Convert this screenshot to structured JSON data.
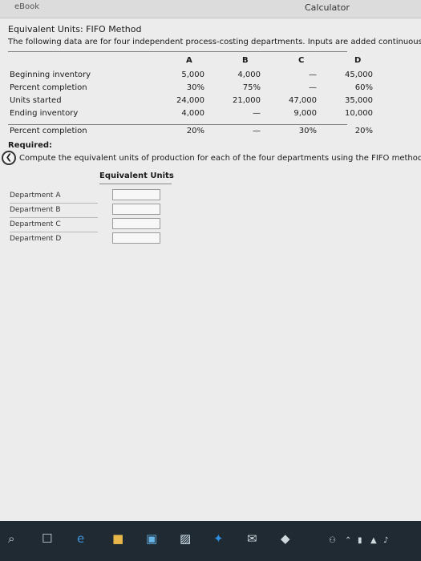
{
  "topbar": {
    "ebook": "eBook",
    "calculator": "Calculator"
  },
  "title": "Equivalent Units: FIFO Method",
  "intro": "The following data are for four independent process-costing departments. Inputs are added continuously.",
  "columns": [
    "A",
    "B",
    "C",
    "D"
  ],
  "rows": [
    {
      "label": "Beginning inventory",
      "values": [
        "5,000",
        "4,000",
        "—",
        "45,000"
      ]
    },
    {
      "label": "Percent completion",
      "values": [
        "30%",
        "75%",
        "—",
        "60%"
      ]
    },
    {
      "label": "Units started",
      "values": [
        "24,000",
        "21,000",
        "47,000",
        "35,000"
      ]
    },
    {
      "label": "Ending inventory",
      "values": [
        "4,000",
        "—",
        "9,000",
        "10,000"
      ]
    },
    {
      "label": "Percent completion",
      "values": [
        "20%",
        "—",
        "30%",
        "20%"
      ]
    }
  ],
  "required": {
    "heading": "Required:",
    "instruction": "Compute the equivalent units of production for each of the four departments using the FIFO method."
  },
  "equivalent_units": {
    "header": "Equivalent Units",
    "departments": [
      {
        "label": "Department A",
        "value": ""
      },
      {
        "label": "Department B",
        "value": ""
      },
      {
        "label": "Department C",
        "value": ""
      },
      {
        "label": "Department D",
        "value": ""
      }
    ]
  },
  "icons": {
    "back": "chevron-left-icon",
    "taskbar": [
      "search-icon",
      "task-view-icon",
      "edge-icon",
      "file-explorer-icon",
      "store-icon",
      "photos-icon",
      "dropbox-icon",
      "mail-icon",
      "unknown-app-icon"
    ],
    "system": [
      "people-icon",
      "chevron-up-icon",
      "battery-icon",
      "network-icon",
      "volume-icon"
    ]
  }
}
